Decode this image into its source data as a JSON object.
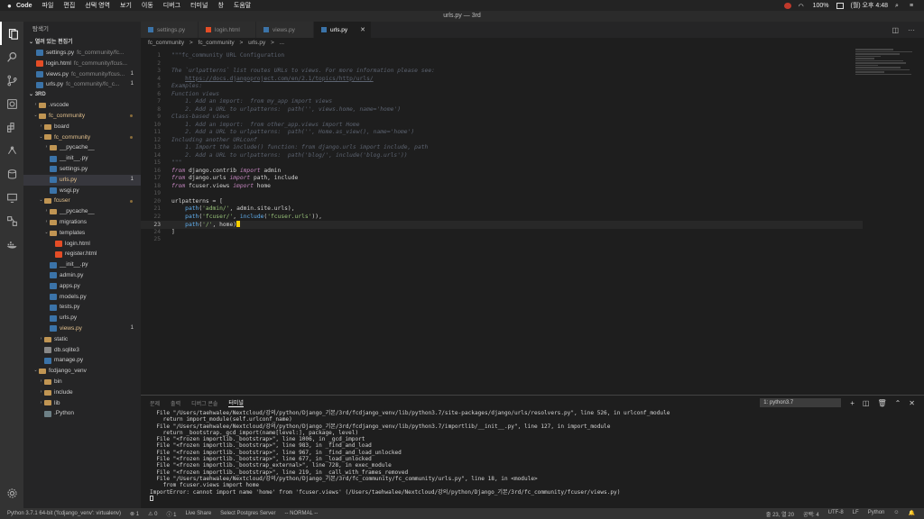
{
  "menubar": {
    "app": "Code",
    "items": [
      "파일",
      "편집",
      "선택 영역",
      "보기",
      "이동",
      "디버그",
      "터미널",
      "창",
      "도움말"
    ],
    "battery": "100%",
    "clock": "(월) 오후 4:48"
  },
  "window_title": "urls.py — 3rd",
  "sidebar": {
    "title": "탐색기",
    "open_editors_label": "열려 있는 편집기",
    "open_editors": [
      {
        "name": "settings.py",
        "desc": "fc_community/fc...",
        "type": "py",
        "badge": ""
      },
      {
        "name": "login.html",
        "desc": "fc_community/fcus...",
        "type": "html",
        "badge": ""
      },
      {
        "name": "views.py",
        "desc": "fc_community/fcus...",
        "type": "py",
        "badge": "1"
      },
      {
        "name": "urls.py",
        "desc": "fc_community/fc_c...",
        "type": "py",
        "badge": "1"
      }
    ],
    "project_label": "3RD",
    "tree": [
      {
        "name": ".vscode",
        "depth": 1,
        "type": "folder",
        "chev": "›",
        "mark": ""
      },
      {
        "name": "fc_community",
        "depth": 1,
        "type": "folder",
        "chev": "⌄",
        "mark": "dot",
        "color": "orange"
      },
      {
        "name": "board",
        "depth": 2,
        "type": "folder",
        "chev": "›",
        "mark": ""
      },
      {
        "name": "fc_community",
        "depth": 2,
        "type": "folder",
        "chev": "⌄",
        "mark": "dot",
        "color": "orange"
      },
      {
        "name": "__pycache__",
        "depth": 3,
        "type": "folder",
        "chev": "›",
        "mark": ""
      },
      {
        "name": "__init__.py",
        "depth": 3,
        "type": "py",
        "chev": "",
        "mark": ""
      },
      {
        "name": "settings.py",
        "depth": 3,
        "type": "py",
        "chev": "",
        "mark": ""
      },
      {
        "name": "urls.py",
        "depth": 3,
        "type": "py",
        "chev": "",
        "mark": "1",
        "selected": true,
        "color": "yellow"
      },
      {
        "name": "wsgi.py",
        "depth": 3,
        "type": "py",
        "chev": "",
        "mark": ""
      },
      {
        "name": "fcuser",
        "depth": 2,
        "type": "folder",
        "chev": "⌄",
        "mark": "dot",
        "color": "orange"
      },
      {
        "name": "__pycache__",
        "depth": 3,
        "type": "folder",
        "chev": "›",
        "mark": ""
      },
      {
        "name": "migrations",
        "depth": 3,
        "type": "folder",
        "chev": "›",
        "mark": ""
      },
      {
        "name": "templates",
        "depth": 3,
        "type": "folder",
        "chev": "⌄",
        "mark": ""
      },
      {
        "name": "login.html",
        "depth": 4,
        "type": "html",
        "chev": "",
        "mark": ""
      },
      {
        "name": "register.html",
        "depth": 4,
        "type": "html",
        "chev": "",
        "mark": ""
      },
      {
        "name": "__init__.py",
        "depth": 3,
        "type": "py",
        "chev": "",
        "mark": ""
      },
      {
        "name": "admin.py",
        "depth": 3,
        "type": "py",
        "chev": "",
        "mark": ""
      },
      {
        "name": "apps.py",
        "depth": 3,
        "type": "py",
        "chev": "",
        "mark": ""
      },
      {
        "name": "models.py",
        "depth": 3,
        "type": "py",
        "chev": "",
        "mark": ""
      },
      {
        "name": "tests.py",
        "depth": 3,
        "type": "py",
        "chev": "",
        "mark": ""
      },
      {
        "name": "urls.py",
        "depth": 3,
        "type": "py",
        "chev": "",
        "mark": ""
      },
      {
        "name": "views.py",
        "depth": 3,
        "type": "py",
        "chev": "",
        "mark": "1",
        "color": "yellow"
      },
      {
        "name": "static",
        "depth": 2,
        "type": "folder",
        "chev": "›",
        "mark": ""
      },
      {
        "name": "db.sqlite3",
        "depth": 2,
        "type": "db",
        "chev": "",
        "mark": ""
      },
      {
        "name": "manage.py",
        "depth": 2,
        "type": "py",
        "chev": "",
        "mark": ""
      },
      {
        "name": "fcdjango_venv",
        "depth": 1,
        "type": "folder",
        "chev": "⌄",
        "mark": ""
      },
      {
        "name": "bin",
        "depth": 2,
        "type": "folder",
        "chev": "›",
        "mark": ""
      },
      {
        "name": "include",
        "depth": 2,
        "type": "folder",
        "chev": "›",
        "mark": ""
      },
      {
        "name": "lib",
        "depth": 2,
        "type": "folder",
        "chev": "›",
        "mark": ""
      },
      {
        "name": ".Python",
        "depth": 2,
        "type": "plain",
        "chev": "",
        "mark": ""
      }
    ]
  },
  "tabs": [
    {
      "label": "settings.py",
      "type": "py",
      "active": false
    },
    {
      "label": "login.html",
      "type": "html",
      "active": false
    },
    {
      "label": "views.py",
      "type": "py",
      "active": false
    },
    {
      "label": "urls.py",
      "type": "py",
      "active": true
    }
  ],
  "breadcrumb": [
    "fc_community",
    ">",
    "fc_community",
    ">",
    "urls.py",
    ">",
    "..."
  ],
  "code_lines": [
    {
      "n": "1",
      "html": "<span class=\"c-str-doc\">\"\"\"fc_community URL Configuration</span>"
    },
    {
      "n": "2",
      "html": ""
    },
    {
      "n": "3",
      "html": "<span class=\"c-com\">The `urlpatterns` list routes URLs to views. For more information please see:</span>"
    },
    {
      "n": "4",
      "html": "<span class=\"c-com\">    </span><span class=\"c-link\">https://docs.djangoproject.com/en/2.1/topics/http/urls/</span>"
    },
    {
      "n": "5",
      "html": "<span class=\"c-com\">Examples:</span>"
    },
    {
      "n": "6",
      "html": "<span class=\"c-com\">Function views</span>"
    },
    {
      "n": "7",
      "html": "<span class=\"c-com\">    1. Add an import:  from my_app import views</span>"
    },
    {
      "n": "8",
      "html": "<span class=\"c-com\">    2. Add a URL to urlpatterns:  path('', views.home, name='home')</span>"
    },
    {
      "n": "9",
      "html": "<span class=\"c-com\">Class-based views</span>"
    },
    {
      "n": "10",
      "html": "<span class=\"c-com\">    1. Add an import:  from other_app.views import Home</span>"
    },
    {
      "n": "11",
      "html": "<span class=\"c-com\">    2. Add a URL to urlpatterns:  path('', Home.as_view(), name='home')</span>"
    },
    {
      "n": "12",
      "html": "<span class=\"c-com\">Including another URLconf</span>"
    },
    {
      "n": "13",
      "html": "<span class=\"c-com\">    1. Import the include() function: from django.urls import include, path</span>"
    },
    {
      "n": "14",
      "html": "<span class=\"c-com\">    2. Add a URL to urlpatterns:  path('blog/', include('blog.urls'))</span>"
    },
    {
      "n": "15",
      "html": "<span class=\"c-str-doc\">\"\"\"</span>"
    },
    {
      "n": "16",
      "html": "<span class=\"c-kw\">from</span><span class=\"c-id\"> django.contrib </span><span class=\"c-kw\">import</span><span class=\"c-id\"> admin</span>"
    },
    {
      "n": "17",
      "html": "<span class=\"c-kw\">from</span><span class=\"c-id\"> django.urls </span><span class=\"c-kw\">import</span><span class=\"c-id\"> path, include</span>"
    },
    {
      "n": "18",
      "html": "<span class=\"c-kw\">from</span><span class=\"c-id\"> fcuser.views </span><span class=\"c-kw\">import</span><span class=\"c-id\"> home</span>"
    },
    {
      "n": "19",
      "html": ""
    },
    {
      "n": "20",
      "html": "<span class=\"c-id\">urlpatterns = [</span>"
    },
    {
      "n": "21",
      "html": "<span class=\"c-id\">    </span><span class=\"c-fn\">path</span><span class=\"c-id\">(</span><span class=\"c-str\">'admin/'</span><span class=\"c-id\">, admin.site.urls),</span>"
    },
    {
      "n": "22",
      "html": "<span class=\"c-id\">    </span><span class=\"c-fn\">path</span><span class=\"c-id\">(</span><span class=\"c-str\">'fcuser/'</span><span class=\"c-id\">, </span><span class=\"c-fn\">include</span><span class=\"c-id\">(</span><span class=\"c-str\">'fcuser.urls'</span><span class=\"c-id\">)),</span>"
    },
    {
      "n": "23",
      "html": "<span class=\"c-id\">    </span><span class=\"c-fn\">path</span><span class=\"c-id\">(</span><span class=\"c-str\">'/'</span><span class=\"c-id\">, home)</span><span class=\"cursor-block\"></span>",
      "current": true
    },
    {
      "n": "24",
      "html": "<span class=\"c-id\">]</span>"
    },
    {
      "n": "25",
      "html": ""
    }
  ],
  "panel": {
    "tabs": [
      "문제",
      "출력",
      "디버그 콘솔",
      "터미널"
    ],
    "active_tab": "터미널",
    "terminal_select": "1: python3.7",
    "terminal_lines": [
      "  File \"/Users/taehwalee/Nextcloud/강의/python/Django_기본/3rd/fcdjango_venv/lib/python3.7/site-packages/django/urls/resolvers.py\", line 526, in urlconf_module",
      "    return import_module(self.urlconf_name)",
      "  File \"/Users/taehwalee/Nextcloud/강의/python/Django_기본/3rd/fcdjango_venv/lib/python3.7/importlib/__init__.py\", line 127, in import_module",
      "    return _bootstrap._gcd_import(name[level:], package, level)",
      "  File \"<frozen importlib._bootstrap>\", line 1006, in _gcd_import",
      "  File \"<frozen importlib._bootstrap>\", line 983, in _find_and_load",
      "  File \"<frozen importlib._bootstrap>\", line 967, in _find_and_load_unlocked",
      "  File \"<frozen importlib._bootstrap>\", line 677, in _load_unlocked",
      "  File \"<frozen importlib._bootstrap_external>\", line 728, in exec_module",
      "  File \"<frozen importlib._bootstrap>\", line 219, in _call_with_frames_removed",
      "  File \"/Users/taehwalee/Nextcloud/강의/python/Django_기본/3rd/fc_community/fc_community/urls.py\", line 18, in <module>",
      "    from fcuser.views import home",
      "ImportError: cannot import name 'home' from 'fcuser.views' (/Users/taehwalee/Nextcloud/강의/python/Django_기본/3rd/fc_community/fcuser/views.py)"
    ]
  },
  "statusbar": {
    "python": "Python 3.7.1 64-bit ('fcdjango_venv': virtualenv)",
    "errors": "⊗ 1",
    "warnings": "⚠ 0",
    "info": "ⓘ 1",
    "live_share": "Live Share",
    "postgres": "Select Postgres Server",
    "vim_mode": "-- NORMAL --",
    "position": "줄 23, 열 20",
    "spaces": "공백: 4",
    "encoding": "UTF-8",
    "eol": "LF",
    "language": "Python"
  }
}
